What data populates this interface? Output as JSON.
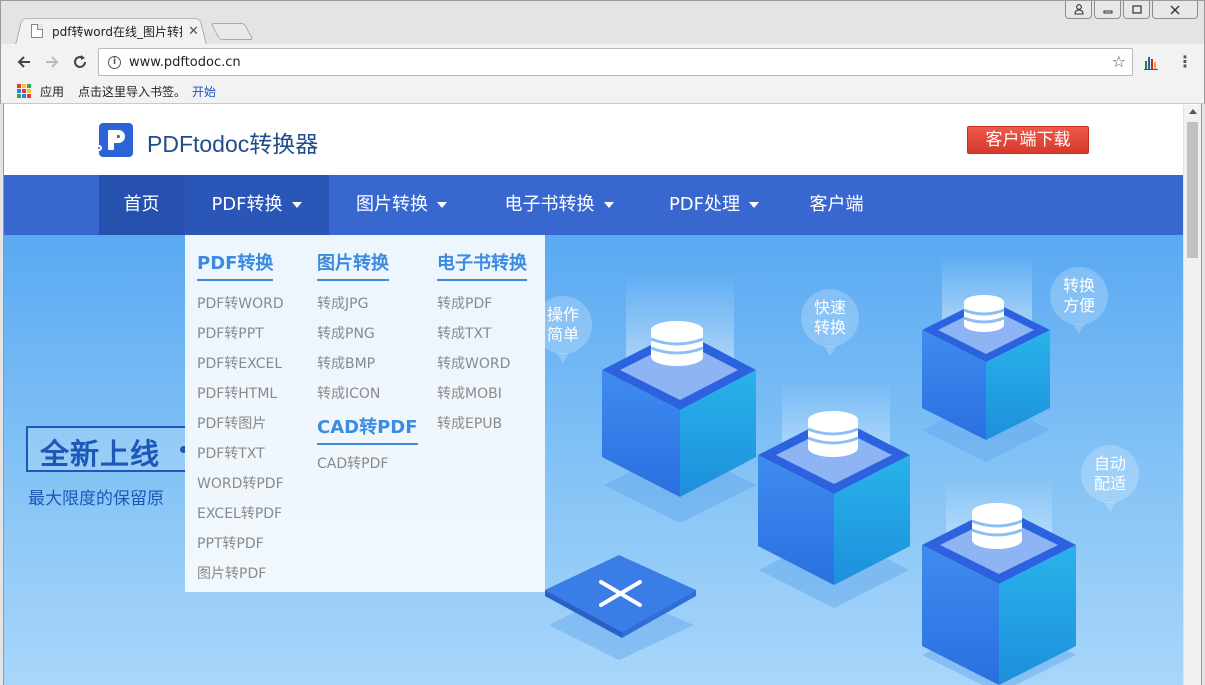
{
  "browser": {
    "tab_title": "pdf转word在线_图片转换",
    "url": "www.pdftodoc.cn",
    "bookmarks": {
      "apps_label": "应用",
      "import_label": "点击这里导入书签。",
      "start_label": "开始"
    },
    "icons": [
      "back-arrow-icon",
      "forward-arrow-icon",
      "reload-icon",
      "info-icon",
      "star-icon",
      "extension-icon",
      "menu-dots-icon",
      "apps-grid-icon",
      "close-icon",
      "user-icon",
      "minimize-icon",
      "maximize-icon"
    ]
  },
  "site": {
    "logo_text": "PDFtodoc转换器",
    "download_label": "客户端下载",
    "nav": [
      {
        "label": "首页",
        "active": true,
        "caret": false
      },
      {
        "label": "PDF转换",
        "active": false,
        "caret": true
      },
      {
        "label": "图片转换",
        "active": false,
        "caret": true
      },
      {
        "label": "电子书转换",
        "active": false,
        "caret": true
      },
      {
        "label": "PDF处理",
        "active": false,
        "caret": true
      },
      {
        "label": "客户端",
        "active": false,
        "caret": false
      }
    ]
  },
  "dropdown": {
    "pdf": {
      "title": "PDF转换",
      "items": [
        "PDF转WORD",
        "PDF转PPT",
        "PDF转EXCEL",
        "PDF转HTML",
        "PDF转图片",
        "PDF转TXT",
        "WORD转PDF",
        "EXCEL转PDF",
        "PPT转PDF",
        "图片转PDF"
      ]
    },
    "image": {
      "title": "图片转换",
      "items": [
        "转成JPG",
        "转成PNG",
        "转成BMP",
        "转成ICON"
      ]
    },
    "cad": {
      "title": "CAD转PDF",
      "items": [
        "CAD转PDF"
      ]
    },
    "ebook": {
      "title": "电子书转换",
      "items": [
        "转成PDF",
        "转成TXT",
        "转成WORD",
        "转成MOBI",
        "转成EPUB"
      ]
    }
  },
  "hero": {
    "badge": "全新上线",
    "subtitle": "最大限度的保留原",
    "bubbles": [
      {
        "line1": "操作",
        "line2": "简单"
      },
      {
        "line1": "快速",
        "line2": "转换"
      },
      {
        "line1": "转换",
        "line2": "方便"
      },
      {
        "line1": "自动",
        "line2": "配适"
      }
    ]
  },
  "colors": {
    "nav_bg": "#3868cf",
    "nav_active": "#2550ad",
    "download_btn": "#e24a3b",
    "dropdown_heading": "#3b8be0",
    "logo_blue": "#2e63d8"
  }
}
